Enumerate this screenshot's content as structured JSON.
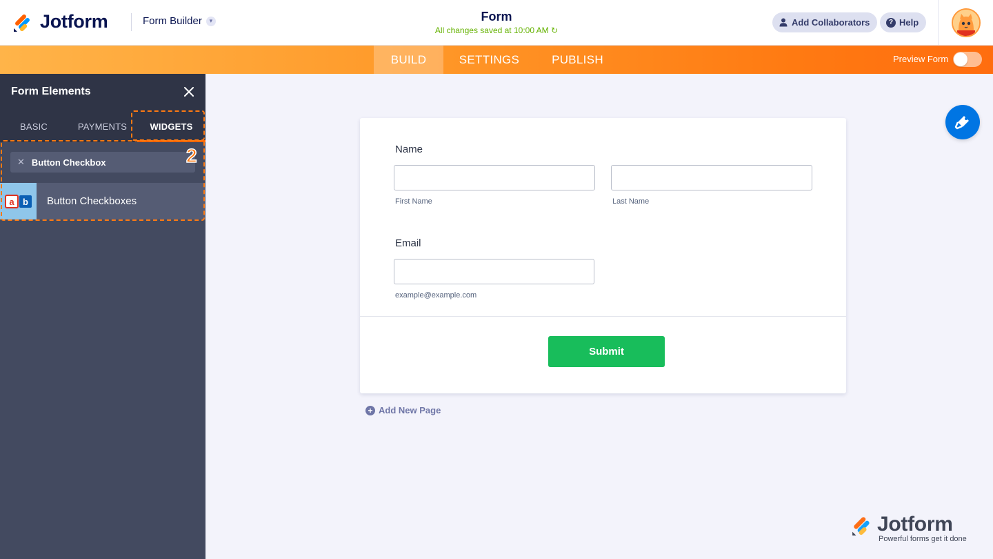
{
  "header": {
    "brand": "Jotform",
    "builder_label": "Form Builder",
    "form_title": "Form",
    "saved_status": "All changes saved at 10:00 AM",
    "collaborators_label": "Add Collaborators",
    "help_label": "Help"
  },
  "nav": {
    "tabs": [
      {
        "label": "BUILD",
        "active": true
      },
      {
        "label": "SETTINGS",
        "active": false
      },
      {
        "label": "PUBLISH",
        "active": false
      }
    ],
    "preview_label": "Preview Form",
    "preview_on": false,
    "accent_color": "#ff6100"
  },
  "sidebar": {
    "title": "Form Elements",
    "tabs": [
      {
        "label": "BASIC",
        "active": false
      },
      {
        "label": "PAYMENTS",
        "active": false
      },
      {
        "label": "WIDGETS",
        "active": true
      }
    ],
    "search_value": "Button Checkbox",
    "results": [
      {
        "label": "Button Checkboxes",
        "icon": "button-checkboxes-icon"
      }
    ],
    "annotation_number": "2"
  },
  "form": {
    "name_label": "Name",
    "first_name_sublabel": "First Name",
    "last_name_sublabel": "Last Name",
    "email_label": "Email",
    "email_sublabel": "example@example.com",
    "submit_label": "Submit",
    "submit_color": "#18bd5b",
    "add_page_label": "Add New Page"
  },
  "watermark": {
    "brand": "Jotform",
    "tagline": "Powerful forms get it done"
  }
}
